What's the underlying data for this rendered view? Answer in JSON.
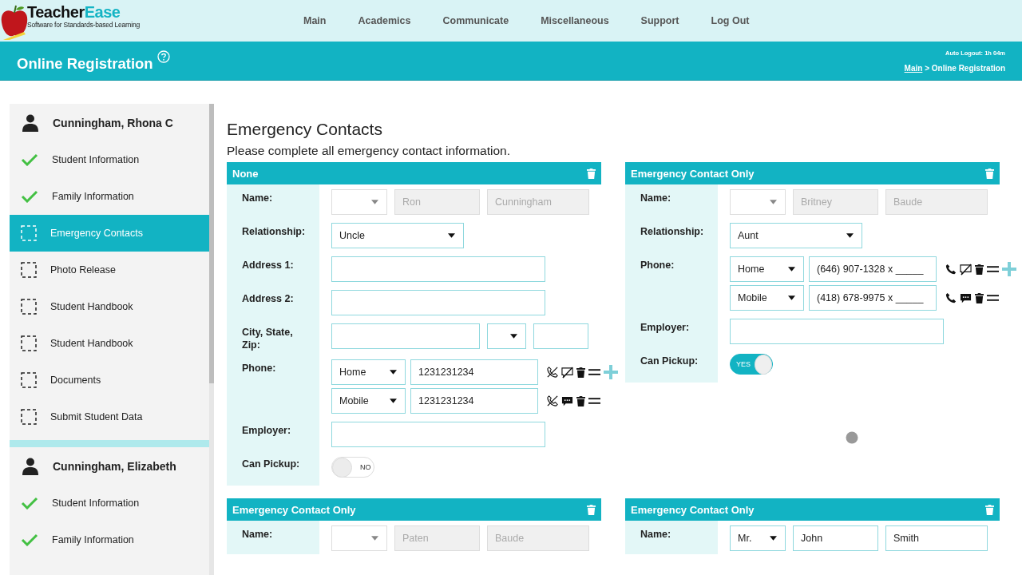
{
  "logo": {
    "name_dark": "Teacher",
    "name_accent": "Ease",
    "tagline": "Software for Standards-based Learning"
  },
  "nav": [
    {
      "label": "Main"
    },
    {
      "label": "Academics"
    },
    {
      "label": "Communicate"
    },
    {
      "label": "Miscellaneous"
    },
    {
      "label": "Support"
    },
    {
      "label": "Log Out"
    }
  ],
  "page_title": "Online Registration",
  "auto_logout": "Auto Logout: 1h 04m",
  "breadcrumb": {
    "link": "Main",
    "current": " > Online Registration"
  },
  "students": [
    {
      "name": "Cunningham, Rhona C",
      "items": [
        {
          "label": "Student Information",
          "done": true,
          "selected": false
        },
        {
          "label": "Family Information",
          "done": true,
          "selected": false
        },
        {
          "label": "Emergency Contacts",
          "done": false,
          "selected": true
        },
        {
          "label": "Photo Release",
          "done": false,
          "selected": false
        },
        {
          "label": "Student Handbook",
          "done": false,
          "selected": false
        },
        {
          "label": "Student Handbook",
          "done": false,
          "selected": false
        },
        {
          "label": "Documents",
          "done": false,
          "selected": false
        },
        {
          "label": "Submit Student Data",
          "done": false,
          "selected": false
        }
      ]
    },
    {
      "name": "Cunningham, Elizabeth",
      "items": [
        {
          "label": "Student Information",
          "done": true,
          "selected": false
        },
        {
          "label": "Family Information",
          "done": true,
          "selected": false
        }
      ]
    }
  ],
  "heading": "Emergency Contacts",
  "instructions": "Please complete all emergency contact information.",
  "contacts": [
    {
      "title": "None",
      "rows": [
        {
          "kind": "name",
          "label": "Name:",
          "disabled": true,
          "first": "Ron",
          "last": "Cunningham"
        },
        {
          "kind": "select",
          "label": "Relationship:",
          "value": "Uncle"
        },
        {
          "kind": "text",
          "label": "Address 1:"
        },
        {
          "kind": "text",
          "label": "Address 2:"
        },
        {
          "kind": "csz",
          "label": "City, State, Zip:"
        },
        {
          "kind": "phones",
          "label": "Phone:",
          "phones": [
            {
              "type": "Home",
              "number": "1231231234",
              "call": false,
              "text": false
            },
            {
              "type": "Mobile",
              "number": "1231231234",
              "call": false,
              "text": true
            }
          ]
        },
        {
          "kind": "text",
          "label": "Employer:"
        },
        {
          "kind": "toggle",
          "label": "Can Pickup:",
          "on": false,
          "text": "NO"
        }
      ]
    },
    {
      "title": "Emergency Contact Only",
      "rows": [
        {
          "kind": "name",
          "label": "Name:",
          "disabled": true,
          "first": "Britney",
          "last": "Baude"
        },
        {
          "kind": "select",
          "label": "Relationship:",
          "value": "Aunt"
        },
        {
          "kind": "phones",
          "label": "Phone:",
          "phones": [
            {
              "type": "Home",
              "number": "(646) 907-1328 x _____",
              "call": true,
              "text": false
            },
            {
              "type": "Mobile",
              "number": "(418) 678-9975 x _____",
              "call": true,
              "text": true
            }
          ]
        },
        {
          "kind": "text",
          "label": "Employer:"
        },
        {
          "kind": "toggle",
          "label": "Can Pickup:",
          "on": true,
          "text": "YES"
        }
      ]
    },
    {
      "title": "Emergency Contact Only",
      "rows": [
        {
          "kind": "name",
          "label": "Name:",
          "disabled": true,
          "first": "Paten",
          "last": "Baude"
        }
      ]
    },
    {
      "title": "Emergency Contact Only",
      "rows": [
        {
          "kind": "name",
          "label": "Name:",
          "disabled": false,
          "prefix": "Mr.",
          "first": "John",
          "last": "Smith"
        }
      ]
    }
  ]
}
